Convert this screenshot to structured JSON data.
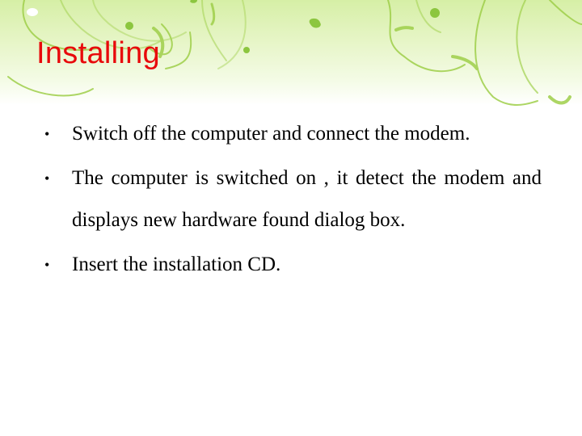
{
  "slide": {
    "title": "Installing",
    "bullet_glyph": "•",
    "bullets": [
      {
        "text": "Switch off the computer and connect the modem."
      },
      {
        "text": "The computer is switched on , it detect the modem and displays new hardware found dialog box."
      },
      {
        "text": "Insert the installation CD."
      }
    ]
  },
  "theme": {
    "title_color": "#e8090b",
    "text_color": "#000000",
    "accent_green": "#8cc63f"
  }
}
